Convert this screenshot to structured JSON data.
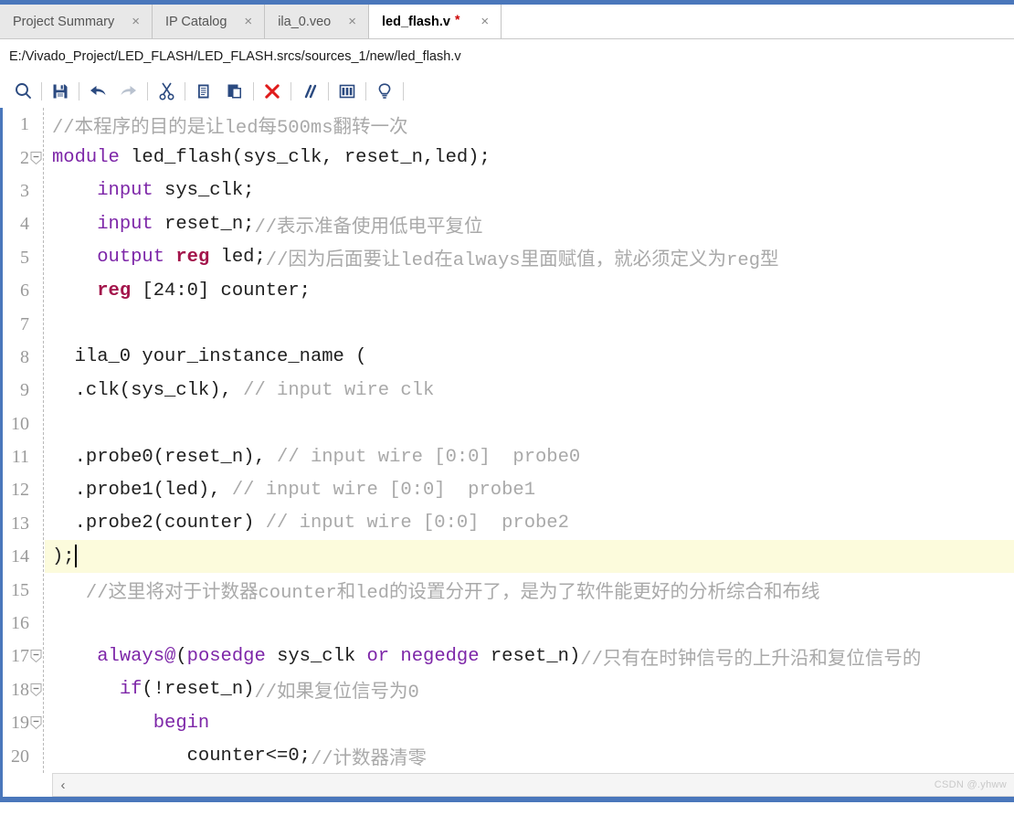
{
  "window": {
    "accent_color": "#4a77bb",
    "tabbar_bg": "#e8e8e8"
  },
  "tabs": [
    {
      "label": "Project Summary",
      "close": "×",
      "active": false
    },
    {
      "label": "IP Catalog",
      "close": "×",
      "active": false
    },
    {
      "label": "ila_0.veo",
      "close": "×",
      "active": false
    },
    {
      "label": "led_flash.v",
      "dirty": "*",
      "close": "×",
      "active": true
    }
  ],
  "path_bar": {
    "path": "E:/Vivado_Project/LED_FLASH/LED_FLASH.srcs/sources_1/new/led_flash.v"
  },
  "toolbar": {
    "buttons": [
      {
        "name": "find-icon",
        "title": "Find"
      },
      {
        "name": "save-icon",
        "title": "Save File"
      },
      {
        "name": "undo-icon",
        "title": "Undo"
      },
      {
        "name": "redo-icon",
        "title": "Redo"
      },
      {
        "name": "cut-icon",
        "title": "Cut"
      },
      {
        "name": "copy-icon",
        "title": "Copy"
      },
      {
        "name": "paste-icon",
        "title": "Paste"
      },
      {
        "name": "delete-icon",
        "title": "Delete"
      },
      {
        "name": "comment-icon",
        "title": "Toggle Comment"
      },
      {
        "name": "columns-icon",
        "title": "Edit Columns"
      },
      {
        "name": "bulb-icon",
        "title": "Show Hints"
      }
    ]
  },
  "editor": {
    "current_line": 14,
    "colors": {
      "keyword": "#7d26a8",
      "type_keyword": "#a3154b",
      "comment": "#a9a9a9",
      "plain": "#202020",
      "current_line_bg": "#fcfbdc",
      "line_number": "#9a9a9a"
    },
    "lines": [
      {
        "n": "1",
        "fold": false,
        "spans": [
          {
            "c": "cmt",
            "t": "//本程序的目的是让led每500ms翻转一次"
          }
        ]
      },
      {
        "n": "2",
        "fold": true,
        "spans": [
          {
            "c": "kw",
            "t": "module"
          },
          {
            "c": "txt",
            "t": " led_flash(sys_clk, reset_n,led);"
          }
        ]
      },
      {
        "n": "3",
        "fold": false,
        "spans": [
          {
            "c": "txt",
            "t": "    "
          },
          {
            "c": "kw",
            "t": "input"
          },
          {
            "c": "txt",
            "t": " sys_clk;"
          }
        ]
      },
      {
        "n": "4",
        "fold": false,
        "spans": [
          {
            "c": "txt",
            "t": "    "
          },
          {
            "c": "kw",
            "t": "input"
          },
          {
            "c": "txt",
            "t": " reset_n;"
          },
          {
            "c": "cmt",
            "t": "//表示准备使用低电平复位"
          }
        ]
      },
      {
        "n": "5",
        "fold": false,
        "spans": [
          {
            "c": "txt",
            "t": "    "
          },
          {
            "c": "kw",
            "t": "output"
          },
          {
            "c": "txt",
            "t": " "
          },
          {
            "c": "kw2",
            "t": "reg"
          },
          {
            "c": "txt",
            "t": " led;"
          },
          {
            "c": "cmt",
            "t": "//因为后面要让led在always里面赋值，就必须定义为reg型"
          }
        ]
      },
      {
        "n": "6",
        "fold": false,
        "spans": [
          {
            "c": "txt",
            "t": "    "
          },
          {
            "c": "kw2",
            "t": "reg"
          },
          {
            "c": "txt",
            "t": " [24:0] counter;"
          }
        ]
      },
      {
        "n": "7",
        "fold": false,
        "spans": [
          {
            "c": "txt",
            "t": ""
          }
        ]
      },
      {
        "n": "8",
        "fold": false,
        "spans": [
          {
            "c": "txt",
            "t": "  ila_0 your_instance_name ("
          }
        ]
      },
      {
        "n": "9",
        "fold": false,
        "spans": [
          {
            "c": "txt",
            "t": "  .clk(sys_clk), "
          },
          {
            "c": "cmt",
            "t": "// input wire clk"
          }
        ]
      },
      {
        "n": "10",
        "fold": false,
        "spans": [
          {
            "c": "txt",
            "t": ""
          }
        ]
      },
      {
        "n": "11",
        "fold": false,
        "spans": [
          {
            "c": "txt",
            "t": "  .probe0(reset_n), "
          },
          {
            "c": "cmt",
            "t": "// input wire [0:0]  probe0"
          }
        ]
      },
      {
        "n": "12",
        "fold": false,
        "spans": [
          {
            "c": "txt",
            "t": "  .probe1(led), "
          },
          {
            "c": "cmt",
            "t": "// input wire [0:0]  probe1"
          }
        ]
      },
      {
        "n": "13",
        "fold": false,
        "spans": [
          {
            "c": "txt",
            "t": "  .probe2(counter) "
          },
          {
            "c": "cmt",
            "t": "// input wire [0:0]  probe2"
          }
        ]
      },
      {
        "n": "14",
        "fold": false,
        "current": true,
        "caret": true,
        "spans": [
          {
            "c": "txt",
            "t": ");"
          }
        ]
      },
      {
        "n": "15",
        "fold": false,
        "spans": [
          {
            "c": "cmt",
            "t": "   //这里将对于计数器counter和led的设置分开了，是为了软件能更好的分析综合和布线"
          }
        ]
      },
      {
        "n": "16",
        "fold": false,
        "spans": [
          {
            "c": "txt",
            "t": ""
          }
        ]
      },
      {
        "n": "17",
        "fold": true,
        "spans": [
          {
            "c": "txt",
            "t": "    "
          },
          {
            "c": "kw",
            "t": "always@"
          },
          {
            "c": "txt",
            "t": "("
          },
          {
            "c": "kw",
            "t": "posedge"
          },
          {
            "c": "txt",
            "t": " sys_clk "
          },
          {
            "c": "kw",
            "t": "or"
          },
          {
            "c": "txt",
            "t": " "
          },
          {
            "c": "kw",
            "t": "negedge"
          },
          {
            "c": "txt",
            "t": " reset_n)"
          },
          {
            "c": "cmt",
            "t": "//只有在时钟信号的上升沿和复位信号的"
          }
        ]
      },
      {
        "n": "18",
        "fold": true,
        "spans": [
          {
            "c": "txt",
            "t": "      "
          },
          {
            "c": "kw",
            "t": "if"
          },
          {
            "c": "txt",
            "t": "(!reset_n)"
          },
          {
            "c": "cmt",
            "t": "//如果复位信号为0"
          }
        ]
      },
      {
        "n": "19",
        "fold": true,
        "spans": [
          {
            "c": "txt",
            "t": "         "
          },
          {
            "c": "kw",
            "t": "begin"
          }
        ]
      },
      {
        "n": "20",
        "fold": false,
        "spans": [
          {
            "c": "txt",
            "t": "            counter<=0;"
          },
          {
            "c": "cmt",
            "t": "//计数器清零"
          }
        ]
      }
    ]
  },
  "scrollbar": {
    "left_arrow": "‹"
  },
  "watermark": {
    "text": "CSDN @.yhww"
  }
}
